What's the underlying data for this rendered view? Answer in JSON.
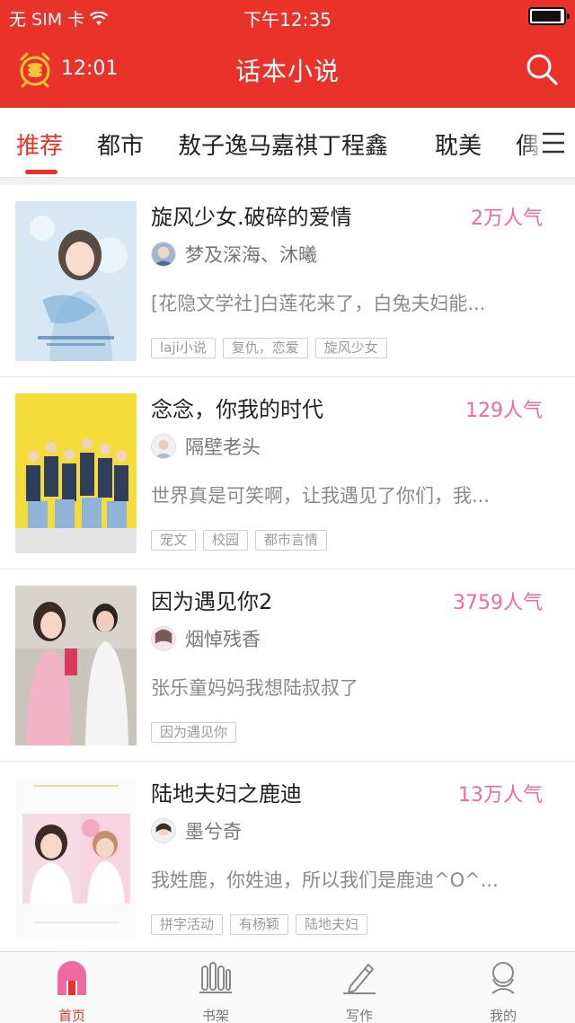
{
  "status_bar": {
    "carrier": "无 SIM 卡",
    "time": "下午12:35"
  },
  "header": {
    "timer": "12:01",
    "title": "话本小说",
    "icons": [
      "alarm-clock-icon",
      "search-icon"
    ]
  },
  "tabs": [
    {
      "label": "推荐",
      "active": true
    },
    {
      "label": "都市",
      "active": false
    },
    {
      "label": "敖子逸马嘉祺丁程鑫",
      "active": false
    },
    {
      "label": "耽美",
      "active": false
    },
    {
      "label": "偶",
      "active": false
    }
  ],
  "books": [
    {
      "title": "旋风少女.破碎的爱情",
      "popularity": "2万人气",
      "author": "梦及深海、沐曦",
      "description": "[花隐文学社]白莲花来了，白兔夫妇能...",
      "tags": [
        "laji小说",
        "复仇，恋爱",
        "旋风少女"
      ]
    },
    {
      "title": "念念，你我的时代",
      "popularity": "129人气",
      "author": "隔壁老头",
      "description": "世界真是可笑啊，让我遇见了你们，我...",
      "tags": [
        "宠文",
        "校园",
        "都市言情"
      ]
    },
    {
      "title": "因为遇见你2",
      "popularity": "3759人气",
      "author": "烟悼残香",
      "description": "张乐童妈妈我想陆叔叔了",
      "tags": [
        "因为遇见你"
      ]
    },
    {
      "title": "陆地夫妇之鹿迪",
      "popularity": "13万人气",
      "author": "墨兮奇",
      "description": "我姓鹿，你姓迪，所以我们是鹿迪^O^...",
      "tags": [
        "拼字活动",
        "有杨颖",
        "陆地夫妇"
      ]
    }
  ],
  "bottom_nav": [
    {
      "label": "首页",
      "icon": "home-icon",
      "active": true
    },
    {
      "label": "书架",
      "icon": "bookshelf-icon",
      "active": false
    },
    {
      "label": "写作",
      "icon": "pencil-icon",
      "active": false
    },
    {
      "label": "我的",
      "icon": "profile-icon",
      "active": false
    }
  ],
  "colors": {
    "brand_red": "#e8322a",
    "popularity_pink": "#ee6aa0"
  }
}
